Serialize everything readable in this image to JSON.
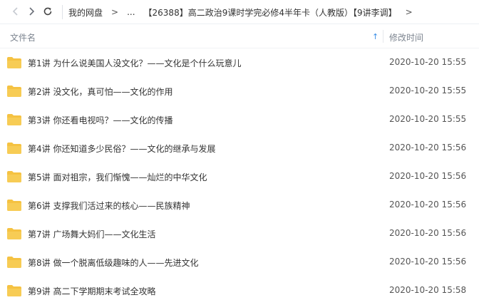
{
  "breadcrumb": {
    "root": "我的网盘",
    "separator": ">",
    "ellipsis": "...",
    "current": "【26388】高二政治9课时学完必修4半年卡（人教版）【9讲李调】"
  },
  "columns": {
    "name": "文件名",
    "modified": "修改时间",
    "sort_arrow": "↑"
  },
  "colors": {
    "folder": "#f5c242",
    "accent": "#3a8ee6"
  },
  "files": [
    {
      "name": "第1讲 为什么说美国人没文化？——文化是个什么玩意儿",
      "modified": "2020-10-20 15:55",
      "icon": "folder-icon"
    },
    {
      "name": "第2讲 没文化，真可怕——文化的作用",
      "modified": "2020-10-20 15:55",
      "icon": "folder-icon"
    },
    {
      "name": "第3讲 你还看电视吗？——文化的传播",
      "modified": "2020-10-20 15:55",
      "icon": "folder-icon"
    },
    {
      "name": "第4讲 你还知道多少民俗？——文化的继承与发展",
      "modified": "2020-10-20 15:56",
      "icon": "folder-icon"
    },
    {
      "name": "第5讲 面对祖宗，我们惭愧——灿烂的中华文化",
      "modified": "2020-10-20 15:56",
      "icon": "folder-icon"
    },
    {
      "name": "第6讲 支撑我们活过来的核心——民族精神",
      "modified": "2020-10-20 15:56",
      "icon": "folder-icon"
    },
    {
      "name": "第7讲 广场舞大妈们——文化生活",
      "modified": "2020-10-20 15:56",
      "icon": "folder-icon"
    },
    {
      "name": "第8讲 做一个脱离低级趣味的人——先进文化",
      "modified": "2020-10-20 15:56",
      "icon": "folder-icon"
    },
    {
      "name": "第9讲 高二下学期期末考试全攻略",
      "modified": "2020-10-20 15:58",
      "icon": "folder-icon"
    }
  ]
}
